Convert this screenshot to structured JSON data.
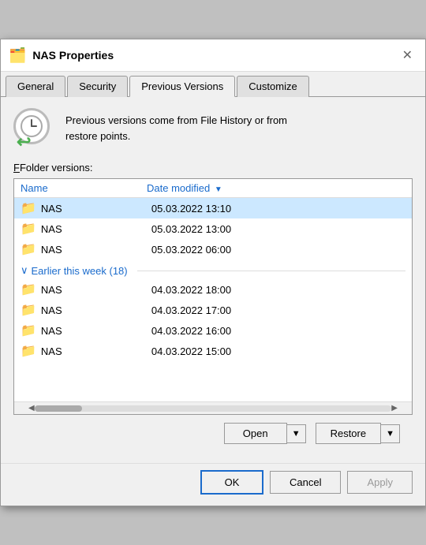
{
  "dialog": {
    "title": "NAS Properties",
    "title_icon": "📁",
    "close_icon": "✕"
  },
  "tabs": [
    {
      "label": "General",
      "active": false
    },
    {
      "label": "Security",
      "active": false
    },
    {
      "label": "Previous Versions",
      "active": true
    },
    {
      "label": "Customize",
      "active": false
    }
  ],
  "info": {
    "text_line1": "Previous versions come from File History or from",
    "text_line2": "restore points."
  },
  "folder_versions_label": "Folder versions:",
  "list": {
    "col_name": "Name",
    "col_date": "Date modified",
    "items_top": [
      {
        "name": "NAS",
        "date": "05.03.2022 13:10",
        "selected": true
      },
      {
        "name": "NAS",
        "date": "05.03.2022 13:00",
        "selected": false
      },
      {
        "name": "NAS",
        "date": "05.03.2022 06:00",
        "selected": false
      }
    ],
    "group_label": "Earlier this week (18)",
    "items_group": [
      {
        "name": "NAS",
        "date": "04.03.2022 18:00",
        "selected": false
      },
      {
        "name": "NAS",
        "date": "04.03.2022 17:00",
        "selected": false
      },
      {
        "name": "NAS",
        "date": "04.03.2022 16:00",
        "selected": false
      },
      {
        "name": "NAS",
        "date": "04.03.2022 15:00",
        "selected": false
      }
    ]
  },
  "action_buttons": {
    "open": "Open",
    "restore": "Restore"
  },
  "footer_buttons": {
    "ok": "OK",
    "cancel": "Cancel",
    "apply": "Apply"
  }
}
